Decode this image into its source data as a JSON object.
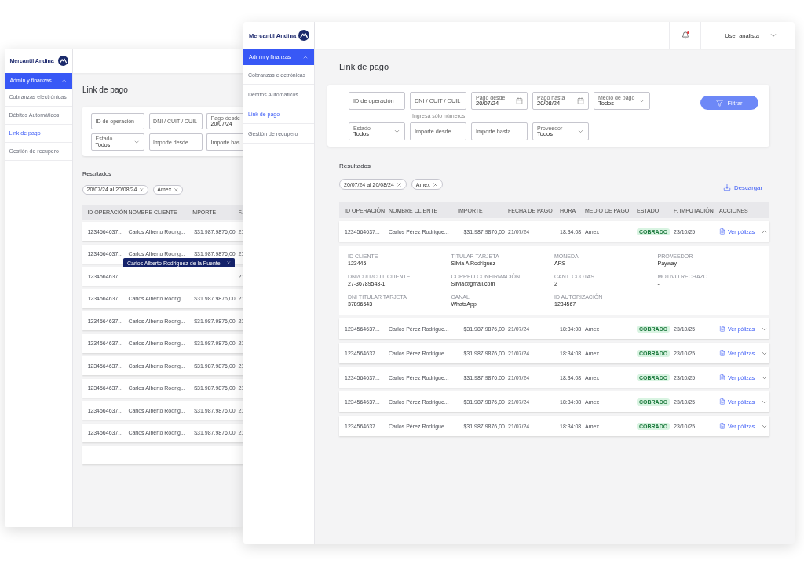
{
  "back_window": {
    "brand": "Mercantil Andina",
    "sidebar": {
      "section": {
        "label": "Admin y finanzas",
        "expanded": true
      },
      "items": [
        {
          "label": "Cobranzas electrónicas",
          "selected": false
        },
        {
          "label": "Débitos Automáticos",
          "selected": false
        },
        {
          "label": "Link de pago",
          "selected": true
        },
        {
          "label": "Gestión de recupero",
          "selected": false
        }
      ]
    },
    "page_title": "Link de pago",
    "filters": [
      [
        {
          "kind": "text",
          "placeholder": "ID de operación"
        },
        {
          "kind": "text",
          "placeholder": "DNI / CUIT / CUIL"
        },
        {
          "kind": "labeled",
          "label": "Pago desde",
          "value": "20/07/24"
        }
      ],
      [
        {
          "kind": "select",
          "label": "Estado",
          "value": "Todos"
        },
        {
          "kind": "text",
          "placeholder": "Importe desde"
        },
        {
          "kind": "text",
          "placeholder": "Importe has"
        }
      ]
    ],
    "results_title": "Resultados",
    "chips": [
      "20/07/24 al 20/08/24",
      "Amex"
    ],
    "table": {
      "columns": [
        "ID OPERACIÓN",
        "NOMBRE CLIENTE",
        "IMPORTE",
        "F."
      ],
      "rows": [
        {
          "id": "1234564637...",
          "name": "Carlos Alberto Rodrig...",
          "amount": "$31.987.9876,00",
          "date": "21"
        },
        {
          "id": "1234564637...",
          "name": "Carlos Alberto Rodrig...",
          "amount": "$31.987.9876,00",
          "date": "21"
        },
        {
          "id": "1234564637...",
          "date": "21"
        },
        {
          "id": "1234564637...",
          "name": "Carlos Alberto Rodrig...",
          "amount": "$31.987.9876,00",
          "date": "21"
        },
        {
          "id": "1234564637...",
          "name": "Carlos Alberto Rodrig...",
          "amount": "$31.987.9876,00",
          "date": "21"
        },
        {
          "id": "1234564637...",
          "name": "Carlos Alberto Rodrig...",
          "amount": "$31.987.9876,00",
          "date": "21"
        },
        {
          "id": "1234564637...",
          "name": "Carlos Alberto Rodrig...",
          "amount": "$31.987.9876,00",
          "date": "21"
        },
        {
          "id": "1234564637...",
          "name": "Carlos Alberto Rodrig...",
          "amount": "$31.987.9876,00",
          "date": "21"
        },
        {
          "id": "1234564637...",
          "name": "Carlos Alberto Rodrig...",
          "amount": "$31.987.9876,00",
          "date": "21"
        },
        {
          "id": "1234564637...",
          "name": "Carlos Alberto Rodrig...",
          "amount": "$31.987.9876,00",
          "date": "21"
        }
      ]
    },
    "tooltip": "Carlos Alberto Rodriguez de la Fuente"
  },
  "front_window": {
    "brand": "Mercantil Andina",
    "sidebar": {
      "section": {
        "label": "Admin y finanzas",
        "expanded": true
      },
      "items": [
        {
          "label": "Cobranzas electrónicas",
          "selected": false
        },
        {
          "label": "Débitos Automáticos",
          "selected": false
        },
        {
          "label": "Link de pago",
          "selected": true
        },
        {
          "label": "Gestión de recupero",
          "selected": false
        }
      ]
    },
    "header": {
      "notifications": true,
      "user": "User analista"
    },
    "page_title": "Link de pago",
    "filters": [
      [
        {
          "kind": "text",
          "placeholder": "ID de operación"
        },
        {
          "kind": "text",
          "placeholder": "DNI / CUIT / CUIL",
          "helper": "Ingresá sólo números"
        },
        {
          "kind": "date",
          "label": "Pago desde",
          "value": "20/07/24"
        },
        {
          "kind": "date",
          "label": "Pago hasta",
          "value": "20/08/24"
        },
        {
          "kind": "select",
          "label": "Medio de pago",
          "value": "Todos"
        }
      ],
      [
        {
          "kind": "select",
          "label": "Estado",
          "value": "Todos"
        },
        {
          "kind": "text",
          "placeholder": "Importe desde"
        },
        {
          "kind": "text",
          "placeholder": "Importe hasta"
        },
        {
          "kind": "select",
          "label": "Proveedor",
          "value": "Todos"
        }
      ]
    ],
    "filter_button": "Filtrar",
    "results_title": "Resultados",
    "chips": [
      "20/07/24 al 20/08/24",
      "Amex"
    ],
    "download": "Descargar",
    "table": {
      "columns": [
        "ID OPERACIÓN",
        "NOMBRE CLIENTE",
        "IMPORTE",
        "FECHA DE PAGO",
        "HORA",
        "MEDIO DE PAGO",
        "ESTADO",
        "F. IMPUTACIÓN",
        "ACCIONES"
      ],
      "rows": [
        {
          "id": "1234564637...",
          "name": "Carlos Pérez Rodrigue...",
          "amount": "$31.987.9876,00",
          "date": "21/07/24",
          "time": "18:34:08",
          "method": "Amex",
          "status": "COBRADO",
          "imputation": "23/10/25",
          "action": "Ver pólizas",
          "expanded": true,
          "details": [
            {
              "label": "ID CLIENTE",
              "value": "123445"
            },
            {
              "label": "TITULAR TARJETA",
              "value": "Silvia A Rodriguez"
            },
            {
              "label": "MONEDA",
              "value": "ARS"
            },
            {
              "label": "PROVEEDOR",
              "value": "Payway"
            },
            {
              "label": "DNI/CUIT/CUIL CLIENTE",
              "value": "27-36789543-1"
            },
            {
              "label": "CORREO CONFIRMACIÓN",
              "value": "Silvia@gmail.com"
            },
            {
              "label": "CANT. CUOTAS",
              "value": "2"
            },
            {
              "label": "MOTIVO RECHAZO",
              "value": "-"
            },
            {
              "label": "DNI TITULAR TARJETA",
              "value": "37896543"
            },
            {
              "label": "CANAL",
              "value": "WhatsApp"
            },
            {
              "label": "ID AUTORIZACIÓN",
              "value": "1234567"
            }
          ]
        },
        {
          "id": "1234564637...",
          "name": "Carlos Pérez Rodrigue...",
          "amount": "$31.987.9876,00",
          "date": "21/07/24",
          "time": "18:34:08",
          "method": "Amex",
          "status": "COBRADO",
          "imputation": "23/10/25",
          "action": "Ver pólizas",
          "expanded": false
        },
        {
          "id": "1234564637...",
          "name": "Carlos Pérez Rodrigue...",
          "amount": "$31.987.9876,00",
          "date": "21/07/24",
          "time": "18:34:08",
          "method": "Amex",
          "status": "COBRADO",
          "imputation": "23/10/25",
          "action": "Ver pólizas",
          "expanded": false
        },
        {
          "id": "1234564637...",
          "name": "Carlos Pérez Rodrigue...",
          "amount": "$31.987.9876,00",
          "date": "21/07/24",
          "time": "18:34:08",
          "method": "Amex",
          "status": "COBRADO",
          "imputation": "23/10/25",
          "action": "Ver pólizas",
          "expanded": false
        },
        {
          "id": "1234564637...",
          "name": "Carlos Pérez Rodrigue...",
          "amount": "$31.987.9876,00",
          "date": "21/07/24",
          "time": "18:34:08",
          "method": "Amex",
          "status": "COBRADO",
          "imputation": "23/10/25",
          "action": "Ver pólizas",
          "expanded": false
        },
        {
          "id": "1234564637...",
          "name": "Carlos Pérez Rodrigue...",
          "amount": "$31.987.9876,00",
          "date": "21/07/24",
          "time": "18:34:08",
          "method": "Amex",
          "status": "COBRADO",
          "imputation": "23/10/25",
          "action": "Ver pólizas",
          "expanded": false
        }
      ]
    }
  }
}
